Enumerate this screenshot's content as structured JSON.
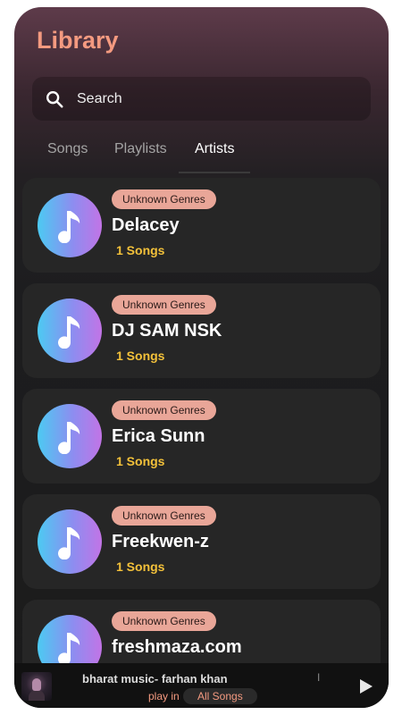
{
  "header": {
    "title": "Library"
  },
  "search": {
    "placeholder": "Search"
  },
  "tabs": [
    {
      "label": "Songs",
      "active": false
    },
    {
      "label": "Playlists",
      "active": false
    },
    {
      "label": "Artists",
      "active": true
    }
  ],
  "artists": [
    {
      "genre": "Unknown Genres",
      "name": "Delacey",
      "songs": "1 Songs"
    },
    {
      "genre": "Unknown Genres",
      "name": "DJ SAM NSK",
      "songs": "1 Songs"
    },
    {
      "genre": "Unknown Genres",
      "name": "Erica Sunn",
      "songs": "1 Songs"
    },
    {
      "genre": "Unknown Genres",
      "name": "Freekwen-z",
      "songs": "1 Songs"
    },
    {
      "genre": "Unknown Genres",
      "name": "freshmaza.com",
      "songs": ""
    }
  ],
  "player": {
    "track_title": "bharat  music- farhan khan",
    "separator": "I",
    "play_in": "play in",
    "source": "All Songs"
  },
  "colors": {
    "accent": "#f49a80",
    "badge": "#e9a698",
    "song_count": "#f3c13a",
    "card": "#262626"
  }
}
